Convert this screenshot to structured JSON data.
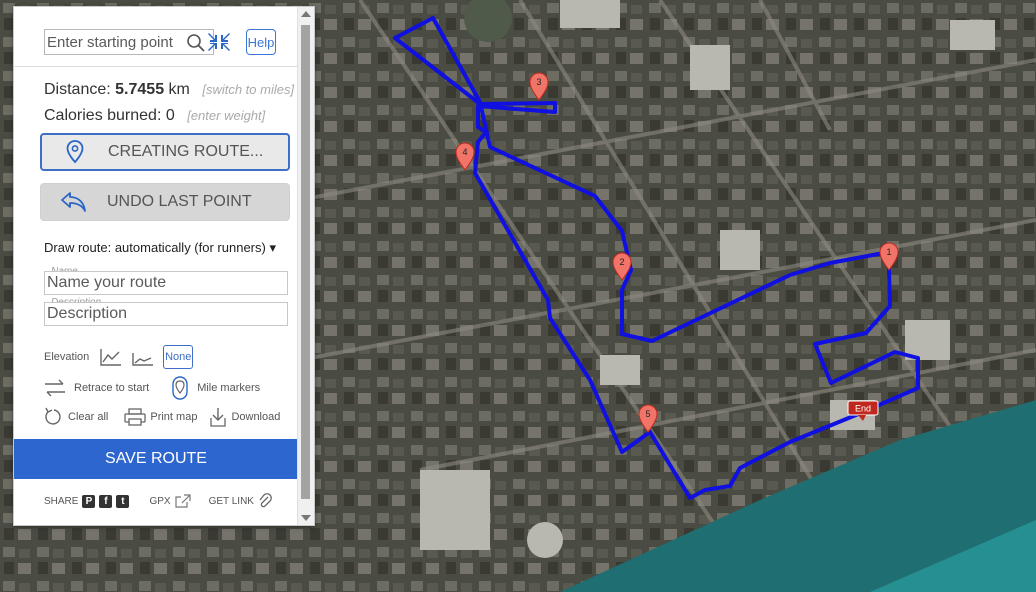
{
  "search": {
    "placeholder": "Enter starting point",
    "help_label": "Help"
  },
  "stats": {
    "distance_label": "Distance:",
    "distance_value": "5.7455",
    "distance_unit": "km",
    "switch_units": "[switch to miles]",
    "calories_label": "Calories burned:",
    "calories_value": "0",
    "enter_weight": "[enter weight]"
  },
  "buttons": {
    "creating_route": "CREATING ROUTE...",
    "undo": "UNDO LAST POINT",
    "save": "SAVE ROUTE"
  },
  "draw_route": {
    "label": "Draw route:",
    "value": "automatically (for runners)"
  },
  "fields": {
    "name_label": "Name",
    "name_placeholder": "Name your route",
    "description_label": "Description",
    "description_placeholder": "Description"
  },
  "options": {
    "elevation_label": "Elevation",
    "elevation_none": "None",
    "retrace": "Retrace to start",
    "mile_markers": "Mile markers",
    "clear_all": "Clear all",
    "print_map": "Print map",
    "download": "Download"
  },
  "share": {
    "label": "SHARE",
    "gpx": "GPX",
    "get_link": "GET LINK"
  },
  "map": {
    "markers": [
      "1",
      "2",
      "3",
      "4",
      "5"
    ],
    "end_label": "End",
    "route_color": "#1010e0",
    "marker_color": "#f07467",
    "end_color": "#c0281e",
    "water_color": "#1f6e72"
  }
}
